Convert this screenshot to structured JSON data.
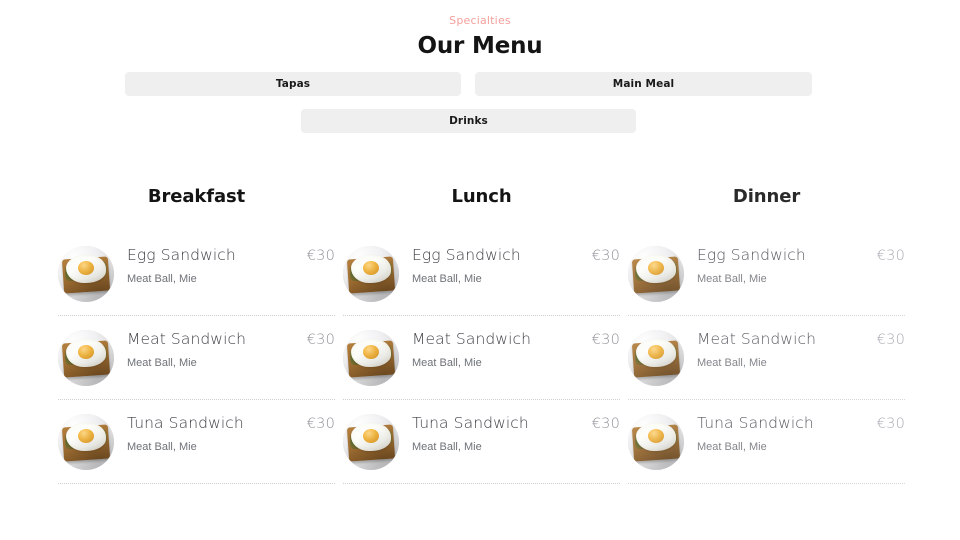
{
  "header": {
    "eyebrow": "Specialties",
    "title": "Our Menu",
    "accent_color": "#f4a09c",
    "title_color": "#141414"
  },
  "tabs": [
    {
      "label": "Tapas"
    },
    {
      "label": "Main Meal"
    },
    {
      "label": "Drinks"
    }
  ],
  "tab_style": {
    "background": "#efefef",
    "text_color": "#1a1a1a"
  },
  "columns": [
    {
      "title": "Breakfast",
      "items": [
        {
          "name": "Egg Sandwich",
          "price": "€30",
          "description": "Meat Ball, Mie",
          "image": "fried-egg-toast-photo"
        },
        {
          "name": "Meat Sandwich",
          "price": "€30",
          "description": "Meat Ball, Mie",
          "image": "fried-egg-toast-photo"
        },
        {
          "name": "Tuna Sandwich",
          "price": "€30",
          "description": "Meat Ball, Mie",
          "image": "fried-egg-toast-photo"
        }
      ]
    },
    {
      "title": "Lunch",
      "items": [
        {
          "name": "Egg Sandwich",
          "price": "€30",
          "description": "Meat Ball, Mie",
          "image": "fried-egg-toast-photo"
        },
        {
          "name": "Meat Sandwich",
          "price": "€30",
          "description": "Meat Ball, Mie",
          "image": "fried-egg-toast-photo"
        },
        {
          "name": "Tuna Sandwich",
          "price": "€30",
          "description": "Meat Ball, Mie",
          "image": "fried-egg-toast-photo"
        }
      ]
    },
    {
      "title": "Dinner",
      "items": [
        {
          "name": "Egg Sandwich",
          "price": "€30",
          "description": "Meat Ball, Mie",
          "image": "fried-egg-toast-photo"
        },
        {
          "name": "Meat Sandwich",
          "price": "€30",
          "description": "Meat Ball, Mie",
          "image": "fried-egg-toast-photo"
        },
        {
          "name": "Tuna Sandwich",
          "price": "€30",
          "description": "Meat Ball, Mie",
          "image": "fried-egg-toast-photo"
        }
      ]
    }
  ]
}
